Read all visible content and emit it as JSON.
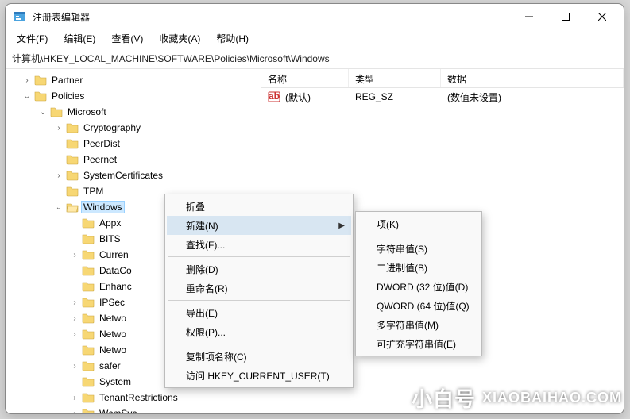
{
  "window": {
    "title": "注册表编辑器"
  },
  "menu": {
    "file": "文件(F)",
    "edit": "编辑(E)",
    "view": "查看(V)",
    "favorites": "收藏夹(A)",
    "help": "帮助(H)"
  },
  "path": "计算机\\HKEY_LOCAL_MACHINE\\SOFTWARE\\Policies\\Microsoft\\Windows",
  "list": {
    "columns": {
      "name": "名称",
      "type": "类型",
      "data": "数据"
    },
    "rows": [
      {
        "name": "(默认)",
        "type": "REG_SZ",
        "data": "(数值未设置)"
      }
    ]
  },
  "tree": {
    "partner": "Partner",
    "policies": "Policies",
    "microsoft": "Microsoft",
    "cryptography": "Cryptography",
    "peerdist": "PeerDist",
    "peernet": "Peernet",
    "systemcertificates": "SystemCertificates",
    "tpm": "TPM",
    "windows": "Windows",
    "appx": "Appx",
    "bits": "BITS",
    "curren": "Curren",
    "dataco": "DataCo",
    "enhanc": "Enhanc",
    "ipsec": "IPSec",
    "netwo1": "Netwo",
    "netwo2": "Netwo",
    "netwo3": "Netwo",
    "safer": "safer",
    "system": "System",
    "tenantrestrictions": "TenantRestrictions",
    "wcmsvc": "WcmSvc"
  },
  "context1": {
    "collapse": "折叠",
    "new": "新建(N)",
    "find": "查找(F)...",
    "delete": "删除(D)",
    "rename": "重命名(R)",
    "export": "导出(E)",
    "permissions": "权限(P)...",
    "copykeyname": "复制项名称(C)",
    "gotohkcu": "访问 HKEY_CURRENT_USER(T)"
  },
  "context2": {
    "key": "项(K)",
    "string": "字符串值(S)",
    "binary": "二进制值(B)",
    "dword": "DWORD (32 位)值(D)",
    "qword": "QWORD (64 位)值(Q)",
    "multistring": "多字符串值(M)",
    "expandstring": "可扩充字符串值(E)"
  },
  "watermark": {
    "cn": "小白号",
    "en": "XIAOBAIHAO.COM"
  }
}
